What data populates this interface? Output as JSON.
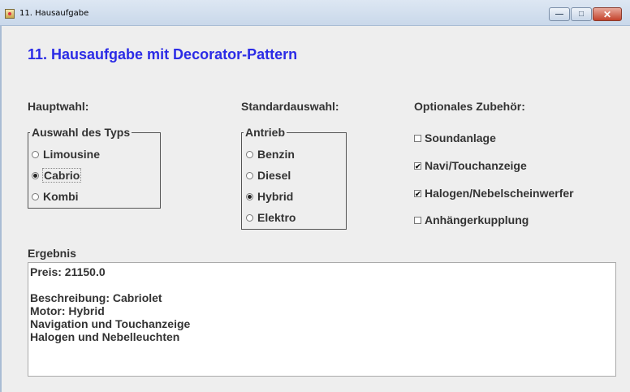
{
  "window": {
    "title": "11. Hausaufgabe",
    "controls": {
      "minimize": "—",
      "maximize": "□",
      "close": "✕"
    }
  },
  "heading": "11. Hausaufgabe mit Decorator-Pattern",
  "sections": {
    "main": "Hauptwahl:",
    "standard": "Standardauswahl:",
    "optional": "Optionales Zubehör:"
  },
  "type_group": {
    "title": "Auswahl des Typs",
    "options": [
      {
        "label": "Limousine",
        "selected": false
      },
      {
        "label": "Cabrio",
        "selected": true
      },
      {
        "label": "Kombi",
        "selected": false
      }
    ]
  },
  "drive_group": {
    "title": "Antrieb",
    "options": [
      {
        "label": "Benzin",
        "selected": false
      },
      {
        "label": "Diesel",
        "selected": false
      },
      {
        "label": "Hybrid",
        "selected": true
      },
      {
        "label": "Elektro",
        "selected": false
      }
    ]
  },
  "accessories": [
    {
      "label": "Soundanlage",
      "checked": false
    },
    {
      "label": "Navi/Touchanzeige",
      "checked": true
    },
    {
      "label": "Halogen/Nebelscheinwerfer",
      "checked": true
    },
    {
      "label": "Anhängerkupplung",
      "checked": false
    }
  ],
  "result": {
    "label": "Ergebnis",
    "lines": [
      "Preis: 21150.0",
      "",
      "Beschreibung: Cabriolet",
      "Motor: Hybrid",
      "Navigation und Touchanzeige",
      "Halogen und Nebelleuchten"
    ]
  }
}
